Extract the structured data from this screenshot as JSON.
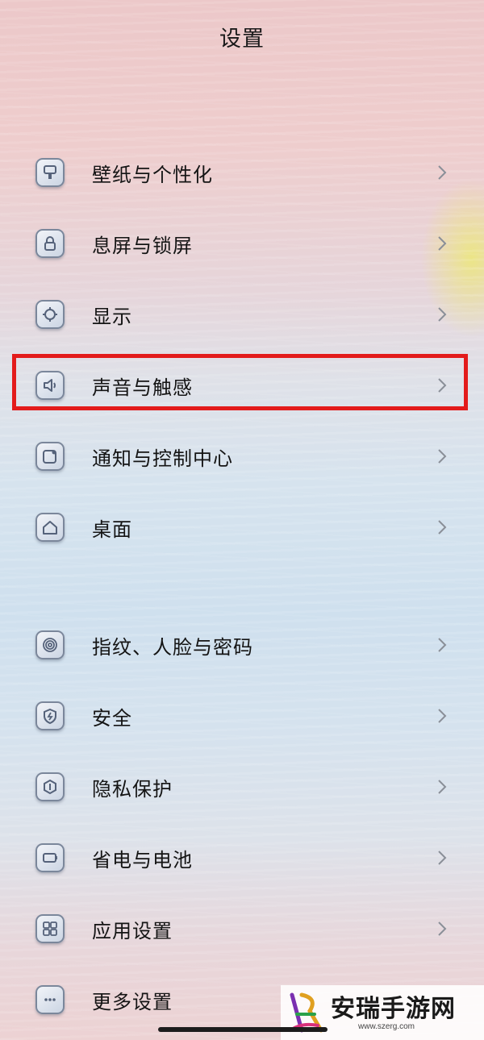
{
  "header": {
    "title": "设置"
  },
  "items": [
    {
      "label": "壁纸与个性化",
      "icon": "wallpaper-icon"
    },
    {
      "label": "息屏与锁屏",
      "icon": "lock-icon"
    },
    {
      "label": "显示",
      "icon": "display-brightness-icon"
    },
    {
      "label": "声音与触感",
      "icon": "speaker-icon",
      "highlighted": true
    },
    {
      "label": "通知与控制中心",
      "icon": "notification-icon"
    },
    {
      "label": "桌面",
      "icon": "home-icon"
    },
    {
      "label": "指纹、人脸与密码",
      "icon": "fingerprint-icon"
    },
    {
      "label": "安全",
      "icon": "shield-icon"
    },
    {
      "label": "隐私保护",
      "icon": "privacy-icon"
    },
    {
      "label": "省电与电池",
      "icon": "battery-icon"
    },
    {
      "label": "应用设置",
      "icon": "apps-grid-icon"
    },
    {
      "label": "更多设置",
      "icon": "more-dots-icon"
    }
  ],
  "watermark": {
    "name": "安瑞手游网",
    "url": "www.szerg.com"
  },
  "colors": {
    "highlight": "#e31b1b",
    "text": "#141414"
  }
}
